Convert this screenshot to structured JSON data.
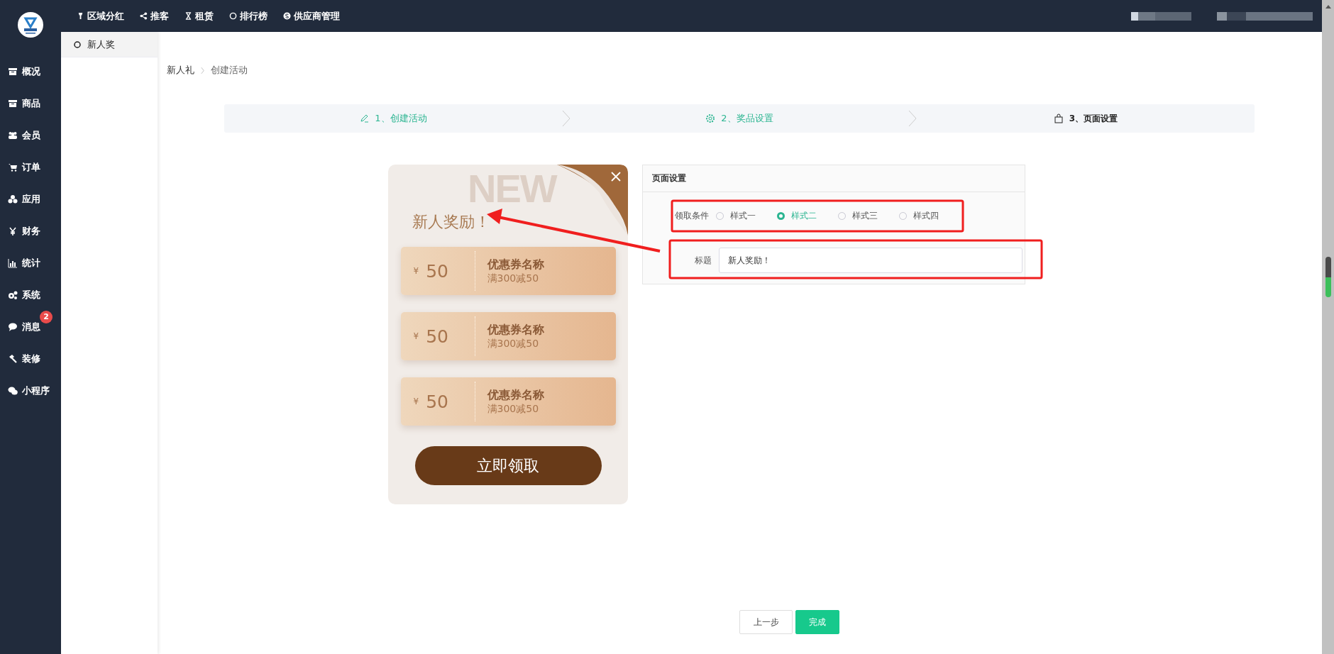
{
  "top_nav": [
    {
      "label": "区域分红"
    },
    {
      "label": "推客"
    },
    {
      "label": "租赁"
    },
    {
      "label": "排行榜"
    },
    {
      "label": "供应商管理"
    }
  ],
  "sidebar": {
    "items": [
      {
        "label": "概况"
      },
      {
        "label": "商品"
      },
      {
        "label": "会员"
      },
      {
        "label": "订单"
      },
      {
        "label": "应用"
      },
      {
        "label": "财务"
      },
      {
        "label": "统计"
      },
      {
        "label": "系统"
      },
      {
        "label": "消息",
        "badge": "2"
      },
      {
        "label": "装修"
      },
      {
        "label": "小程序"
      }
    ]
  },
  "sub_sidebar": {
    "items": [
      {
        "label": "新人奖",
        "selected": true
      }
    ]
  },
  "breadcrumb": [
    "新人礼",
    "创建活动"
  ],
  "steps": [
    {
      "label": "1、创建活动",
      "selected": false
    },
    {
      "label": "2、奖品设置",
      "selected": false
    },
    {
      "label": "3、页面设置",
      "selected": true
    }
  ],
  "preview": {
    "watermark": "NEW",
    "title": "新人奖励！",
    "coupons": [
      {
        "currency": "¥",
        "amount": "50",
        "name": "优惠券名称",
        "condition": "满300减50"
      },
      {
        "currency": "¥",
        "amount": "50",
        "name": "优惠券名称",
        "condition": "满300减50"
      },
      {
        "currency": "¥",
        "amount": "50",
        "name": "优惠券名称",
        "condition": "满300减50"
      }
    ],
    "button": "立即领取"
  },
  "settings": {
    "header": "页面设置",
    "condition_label": "领取条件",
    "options": [
      {
        "label": "样式一",
        "selected": false
      },
      {
        "label": "样式二",
        "selected": true
      },
      {
        "label": "样式三",
        "selected": false
      },
      {
        "label": "样式四",
        "selected": false
      }
    ],
    "title_label": "标题",
    "title_value": "新人奖励！"
  },
  "buttons": [
    {
      "label": "上一步",
      "kind": "default"
    },
    {
      "label": "完成",
      "kind": "primary"
    }
  ]
}
